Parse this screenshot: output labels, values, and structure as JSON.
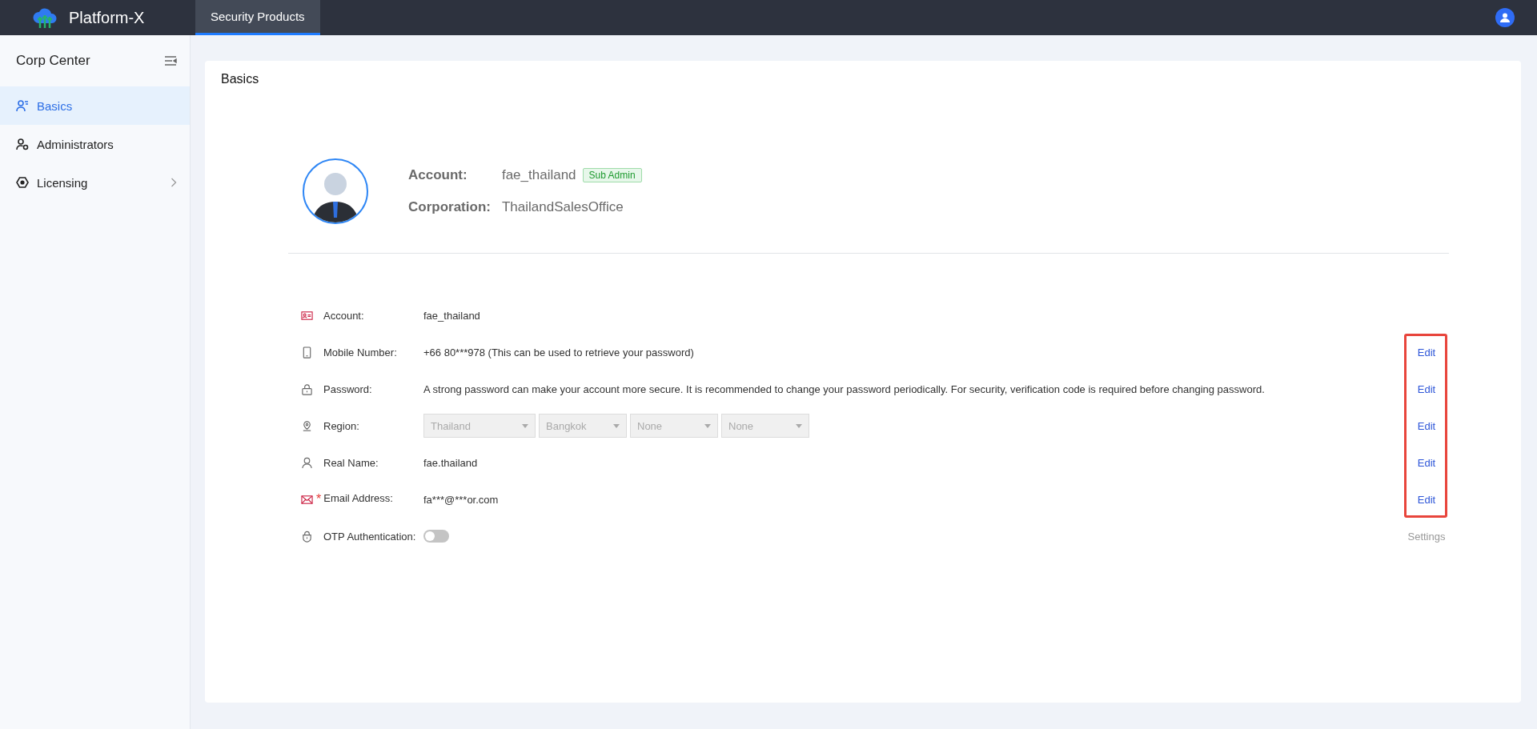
{
  "topbar": {
    "brand": "Platform-X",
    "tabs": [
      {
        "label": "Security Products",
        "selected": true
      }
    ]
  },
  "sidebar": {
    "title": "Corp Center",
    "items": [
      {
        "label": "Basics",
        "selected": true,
        "expandable": false
      },
      {
        "label": "Administrators",
        "selected": false,
        "expandable": false
      },
      {
        "label": "Licensing",
        "selected": false,
        "expandable": true
      }
    ]
  },
  "card": {
    "title": "Basics",
    "profile": {
      "fields": [
        {
          "label": "Account:",
          "value": "fae_thailand",
          "tag": "Sub Admin"
        },
        {
          "label": "Corporation:",
          "value": "ThailandSalesOffice"
        }
      ]
    },
    "details": [
      {
        "kind": "text",
        "label": "Account:",
        "value": "fae_thailand"
      },
      {
        "kind": "text",
        "label": "Mobile Number:",
        "value": "+66 80***978 (This can be used to retrieve your password)",
        "action": {
          "label": "Edit",
          "disabled": false,
          "highlighted": true
        }
      },
      {
        "kind": "text",
        "label": "Password:",
        "value": "A strong password can make your account more secure. It is recommended to change your password periodically. For security, verification code is required before changing password.",
        "action": {
          "label": "Edit",
          "disabled": false,
          "highlighted": true
        }
      },
      {
        "kind": "select",
        "label": "Region:",
        "selects": [
          "Thailand",
          "Bangkok",
          "None",
          "None"
        ],
        "action": {
          "label": "Edit",
          "disabled": false,
          "highlighted": true
        }
      },
      {
        "kind": "text",
        "label": "Real Name:",
        "value": "fae.thailand",
        "action": {
          "label": "Edit",
          "disabled": false,
          "highlighted": true
        }
      },
      {
        "kind": "text",
        "label": "Email Address:",
        "required_mark": "*",
        "value": "fa***@***or.com",
        "action": {
          "label": "Edit",
          "disabled": false,
          "highlighted": true
        }
      },
      {
        "kind": "toggle",
        "label": "OTP Authentication:",
        "on": false,
        "action": {
          "label": "Settings",
          "disabled": true,
          "highlighted": false
        }
      }
    ]
  }
}
